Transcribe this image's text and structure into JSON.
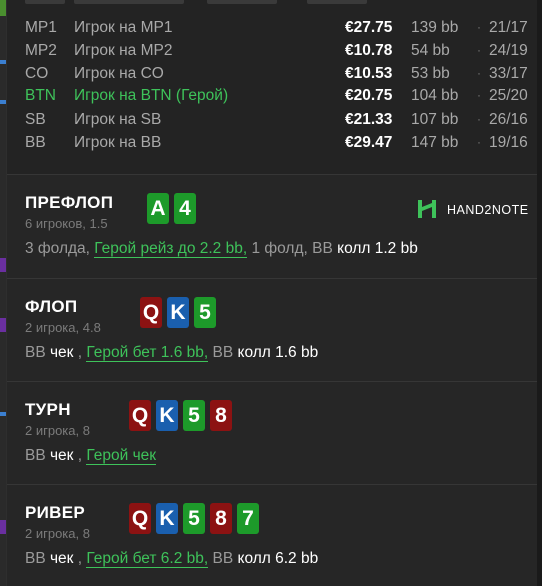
{
  "players": [
    {
      "pos": "MP1",
      "name": "Игрок на MP1",
      "money": "€27.75",
      "bb": "139 bb",
      "dot": "·",
      "ratio": "21/17",
      "hero": false
    },
    {
      "pos": "MP2",
      "name": "Игрок на MP2",
      "money": "€10.78",
      "bb": "54 bb",
      "dot": "·",
      "ratio": "24/19",
      "hero": false
    },
    {
      "pos": "CO",
      "name": "Игрок на CO",
      "money": "€10.53",
      "bb": "53 bb",
      "dot": "·",
      "ratio": "33/17",
      "hero": false
    },
    {
      "pos": "BTN",
      "name": "Игрок на BTN (Герой)",
      "money": "€20.75",
      "bb": "104 bb",
      "dot": "·",
      "ratio": "25/20",
      "hero": true
    },
    {
      "pos": "SB",
      "name": "Игрок на SB",
      "money": "€21.33",
      "bb": "107 bb",
      "dot": "·",
      "ratio": "26/16",
      "hero": false
    },
    {
      "pos": "BB",
      "name": "Игрок на BB",
      "money": "€29.47",
      "bb": "147 bb",
      "dot": "·",
      "ratio": "19/16",
      "hero": false
    }
  ],
  "logo": {
    "text": "HAND2NOTE",
    "icon": "hand2note-logo-icon"
  },
  "streets": {
    "preflop": {
      "title": "ПРЕФЛОП",
      "sub": "6 игроков, 1.5",
      "cards": [
        {
          "rank": "A",
          "suit": "c"
        },
        {
          "rank": "4",
          "suit": "c"
        }
      ],
      "action": {
        "p1": "3 фолда, ",
        "hero": "Герой рейз до 2.2 bb,",
        "p2": " 1 фолд, BB ",
        "w1": "колл 1.2 bb"
      }
    },
    "flop": {
      "title": "ФЛОП",
      "sub": "2 игрока, 4.8",
      "cards": [
        {
          "rank": "Q",
          "suit": "h"
        },
        {
          "rank": "K",
          "suit": "d"
        },
        {
          "rank": "5",
          "suit": "c"
        }
      ],
      "action": {
        "p1": "BB ",
        "w1": "чек",
        "p2": " , ",
        "hero": "Герой бет 1.6 bb,",
        "p3": " BB ",
        "w2": "колл 1.6 bb"
      }
    },
    "turn": {
      "title": "ТУРН",
      "sub": "2 игрока, 8",
      "cards": [
        {
          "rank": "Q",
          "suit": "h"
        },
        {
          "rank": "K",
          "suit": "d"
        },
        {
          "rank": "5",
          "suit": "c"
        },
        {
          "rank": "8",
          "suit": "h"
        }
      ],
      "action": {
        "p1": "BB ",
        "w1": "чек",
        "p2": " , ",
        "hero": "Герой чек"
      }
    },
    "river": {
      "title": "РИВЕР",
      "sub": "2 игрока, 8",
      "cards": [
        {
          "rank": "Q",
          "suit": "h"
        },
        {
          "rank": "K",
          "suit": "d"
        },
        {
          "rank": "5",
          "suit": "c"
        },
        {
          "rank": "8",
          "suit": "h"
        },
        {
          "rank": "7",
          "suit": "c"
        }
      ],
      "action": {
        "p1": "BB ",
        "w1": "чек",
        "p2": " , ",
        "hero": "Герой бет 6.2 bb,",
        "p3": " BB ",
        "w2": "колл 6.2 bb"
      }
    }
  },
  "colors": {
    "hero": "#3ec25a",
    "hearts": "#8c1212",
    "diamonds": "#1a5fae",
    "clubs": "#1d9a2a"
  }
}
